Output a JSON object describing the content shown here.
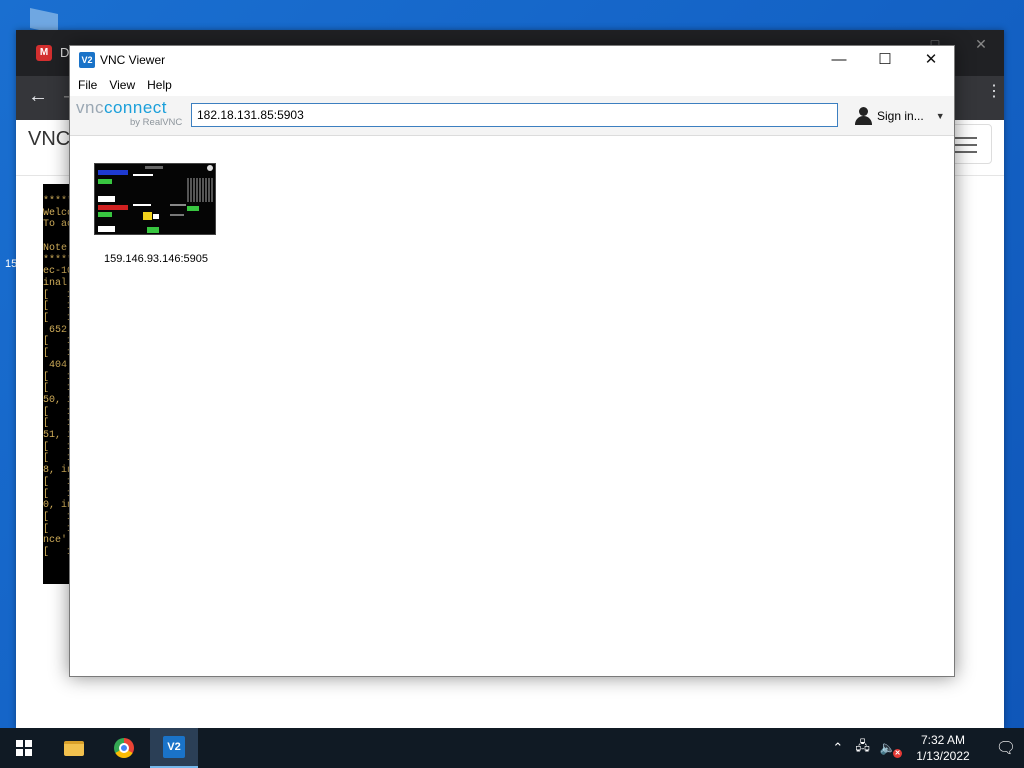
{
  "desktop": {
    "stray_label": "15"
  },
  "browser": {
    "tab_icon_letter": "M",
    "tab_text": "D",
    "page_title": "VNC",
    "terminal_lines": [
      "*****",
      "Welco",
      "To ac",
      "",
      "Note:",
      "*****",
      "ec-10",
      "inal",
      "[   1",
      "[   1",
      "[   1",
      " 652.",
      "[   1",
      "[   1",
      " 404.",
      "[   1",
      "[   1",
      "50, i",
      "[   1",
      "[   1",
      "51, i",
      "[   1",
      "[   1",
      "8, in",
      "[   1",
      "[   1",
      "0, in",
      "[   1",
      "[   1",
      "nce'",
      "[   1"
    ]
  },
  "vnc": {
    "logo_text": "V2",
    "title": "VNC Viewer",
    "menu": [
      "File",
      "View",
      "Help"
    ],
    "brand": {
      "part1": "vnc",
      "part2": "connect",
      "sub": "by RealVNC"
    },
    "address": "182.18.131.85:5903",
    "signin_label": "Sign in...",
    "connections": [
      {
        "label": "159.146.93.146:5905"
      }
    ]
  },
  "taskbar": {
    "vnc_icon": "V2",
    "clock_time": "7:32 AM",
    "clock_date": "1/13/2022"
  },
  "icons": {
    "minimize": "minimize-icon",
    "maximize": "maximize-icon",
    "close": "close-icon",
    "back": "back-arrow-icon",
    "user": "user-icon",
    "caret": "dropdown-caret-icon"
  }
}
